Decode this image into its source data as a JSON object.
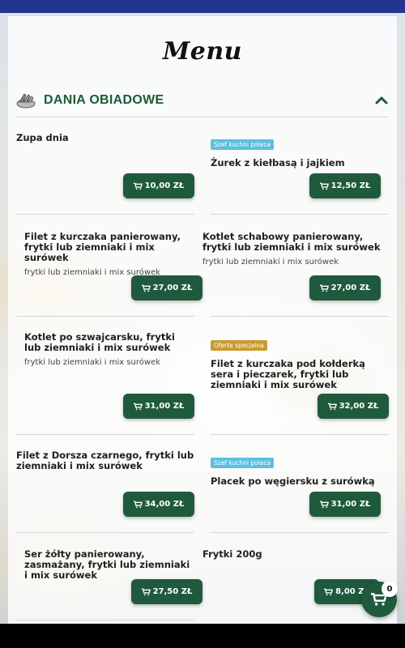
{
  "page": {
    "title": "Menu"
  },
  "section": {
    "title": "DANIA OBIADOWE",
    "icon": "dish-icon",
    "toggle_icon": "chevron-up-icon"
  },
  "colors": {
    "primary": "#1f5a3d",
    "badge_chef": "#5bc0de",
    "badge_special": "#c99a33",
    "top_bar": "#24358f"
  },
  "items": [
    {
      "name": "Zupa dnia",
      "description": "",
      "badge": "",
      "price": "10,00 ZŁ"
    },
    {
      "name": "Żurek z kiełbasą i jajkiem",
      "description": "",
      "badge": "Szef kuchni poleca",
      "price": "12,50 ZŁ"
    },
    {
      "name": "Filet z kurczaka panierowany, frytki lub ziemniaki i mix surówek",
      "description": "frytki lub ziemniaki i mix surówek",
      "badge": "",
      "price": "27,00 ZŁ"
    },
    {
      "name": "Kotlet schabowy panierowany, frytki lub ziemniaki i mix surówek",
      "description": "frytki lub ziemniaki i mix surówek",
      "badge": "",
      "price": "27,00 ZŁ"
    },
    {
      "name": "Kotlet po szwajcarsku, frytki lub ziemniaki i mix surówek",
      "description": "frytki lub ziemniaki i mix surówek",
      "badge": "",
      "price": "31,00 ZŁ"
    },
    {
      "name": "Filet z kurczaka pod kołderką sera i pieczarek, frytki lub ziemniaki i mix surówek",
      "description": "",
      "badge": "Oferta specjalna",
      "price": "32,00 ZŁ"
    },
    {
      "name": "Filet z Dorsza czarnego, frytki lub ziemniaki i mix surówek",
      "description": "",
      "badge": "",
      "price": "34,00 ZŁ"
    },
    {
      "name": "Placek po węgiersku z surówką",
      "description": "",
      "badge": "Szef kuchni poleca",
      "price": "31,00 ZŁ"
    },
    {
      "name": "Ser żółty panierowany, zasmażany, frytki lub ziemniaki i mix surówek",
      "description": "",
      "badge": "",
      "price": "27,50 ZŁ"
    },
    {
      "name": "Frytki 200g",
      "description": "",
      "badge": "",
      "price": "8,00 ZŁ"
    }
  ],
  "cart": {
    "count": "0",
    "icon": "cart-icon"
  }
}
